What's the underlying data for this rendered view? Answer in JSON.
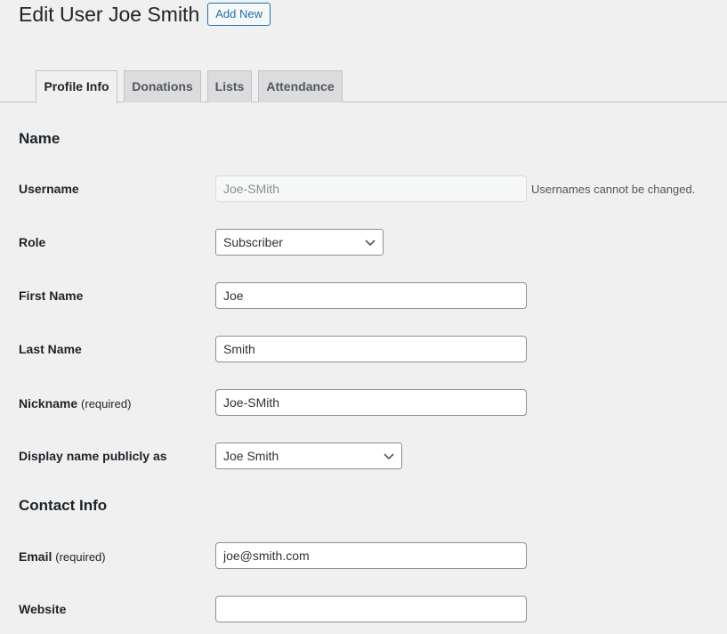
{
  "header": {
    "title": "Edit User Joe Smith",
    "add_new_label": "Add New"
  },
  "tabs": [
    {
      "label": "Profile Info",
      "active": true
    },
    {
      "label": "Donations",
      "active": false
    },
    {
      "label": "Lists",
      "active": false
    },
    {
      "label": "Attendance",
      "active": false
    }
  ],
  "sections": {
    "name": "Name",
    "contact": "Contact Info"
  },
  "fields": {
    "username": {
      "label": "Username",
      "value": "Joe-SMith",
      "help": "Usernames cannot be changed."
    },
    "role": {
      "label": "Role",
      "value": "Subscriber"
    },
    "first_name": {
      "label": "First Name",
      "value": "Joe"
    },
    "last_name": {
      "label": "Last Name",
      "value": "Smith"
    },
    "nickname": {
      "label": "Nickname",
      "required": "(required)",
      "value": "Joe-SMith"
    },
    "display_name": {
      "label": "Display name publicly as",
      "value": "Joe Smith"
    },
    "email": {
      "label": "Email",
      "required": "(required)",
      "value": "joe@smith.com"
    },
    "website": {
      "label": "Website",
      "value": ""
    }
  },
  "icons": {
    "dropdown": "chevron-down-icon"
  },
  "colors": {
    "accent": "#2271b1",
    "background": "#f0f0f1",
    "tab_inactive": "#dcdcde"
  }
}
